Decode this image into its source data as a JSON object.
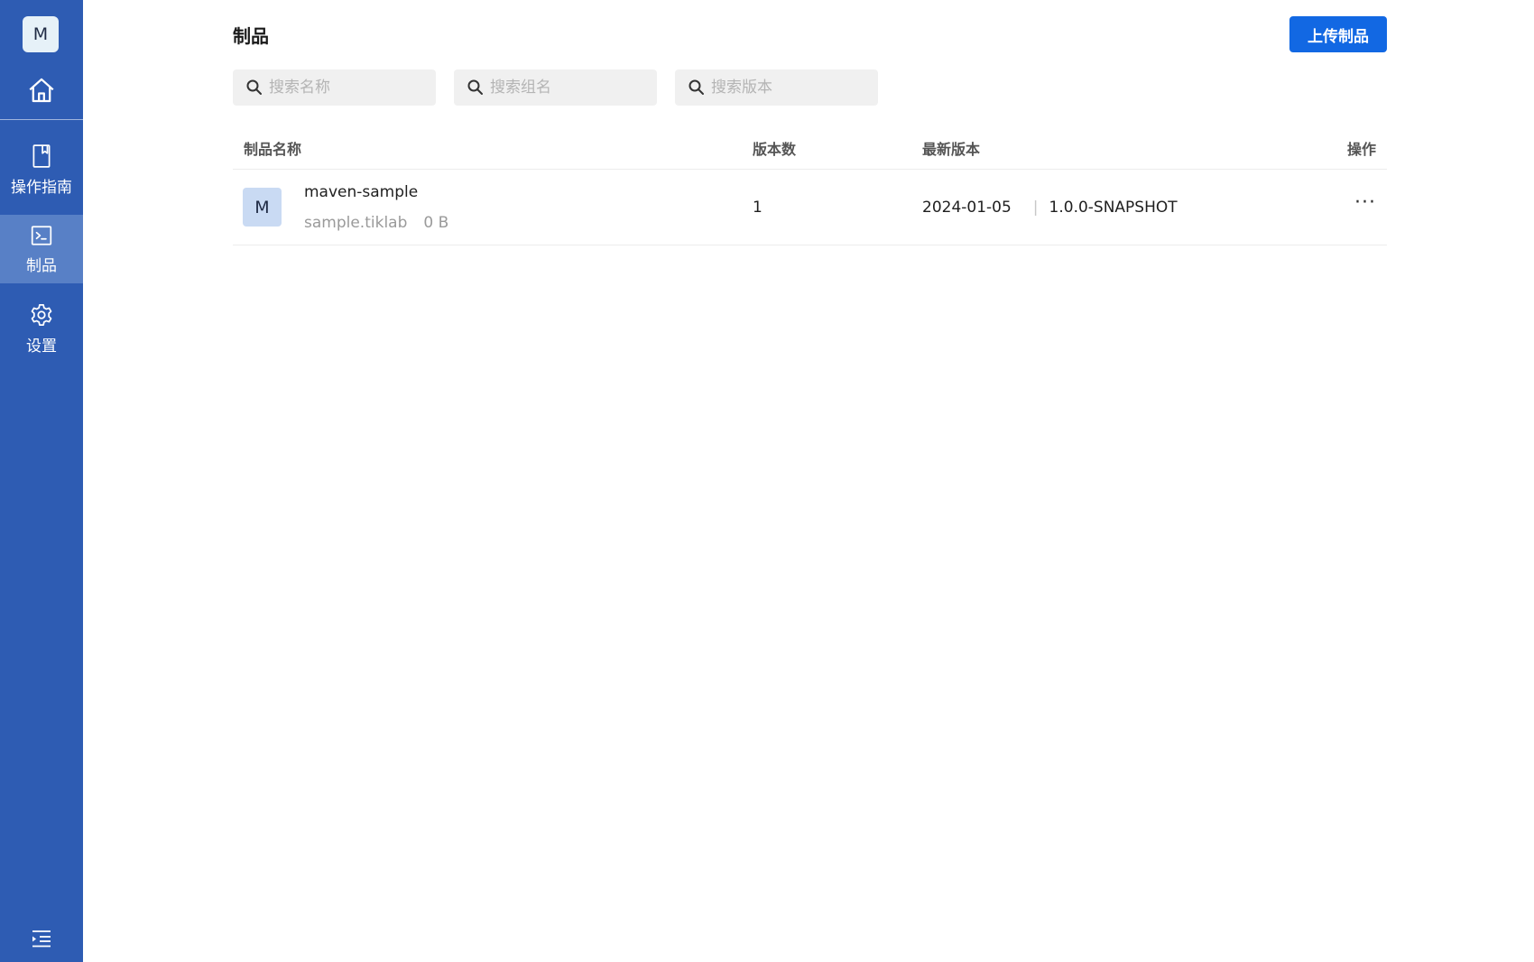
{
  "sidebar": {
    "avatar_letter": "M",
    "items": [
      {
        "label": "操作指南",
        "icon": "book-icon"
      },
      {
        "label": "制品",
        "icon": "terminal-icon",
        "active": true
      },
      {
        "label": "设置",
        "icon": "gear-icon"
      }
    ]
  },
  "header": {
    "title": "制品",
    "upload_label": "上传制品"
  },
  "search": {
    "name_placeholder": "搜索名称",
    "group_placeholder": "搜索组名",
    "version_placeholder": "搜索版本"
  },
  "table": {
    "columns": [
      "制品名称",
      "版本数",
      "最新版本",
      "操作"
    ],
    "rows": [
      {
        "avatar": "M",
        "name": "maven-sample",
        "group": "sample.tiklab",
        "size": "0 B",
        "version_count": "1",
        "latest_date": "2024-01-05",
        "latest_version": "1.0.0-SNAPSHOT",
        "ops": "···"
      }
    ]
  },
  "colors": {
    "sidebar_bg": "#2e5cb3",
    "sidebar_active": "#5880c6",
    "primary_button": "#1268e3",
    "row_avatar_bg": "#c9daf3"
  }
}
